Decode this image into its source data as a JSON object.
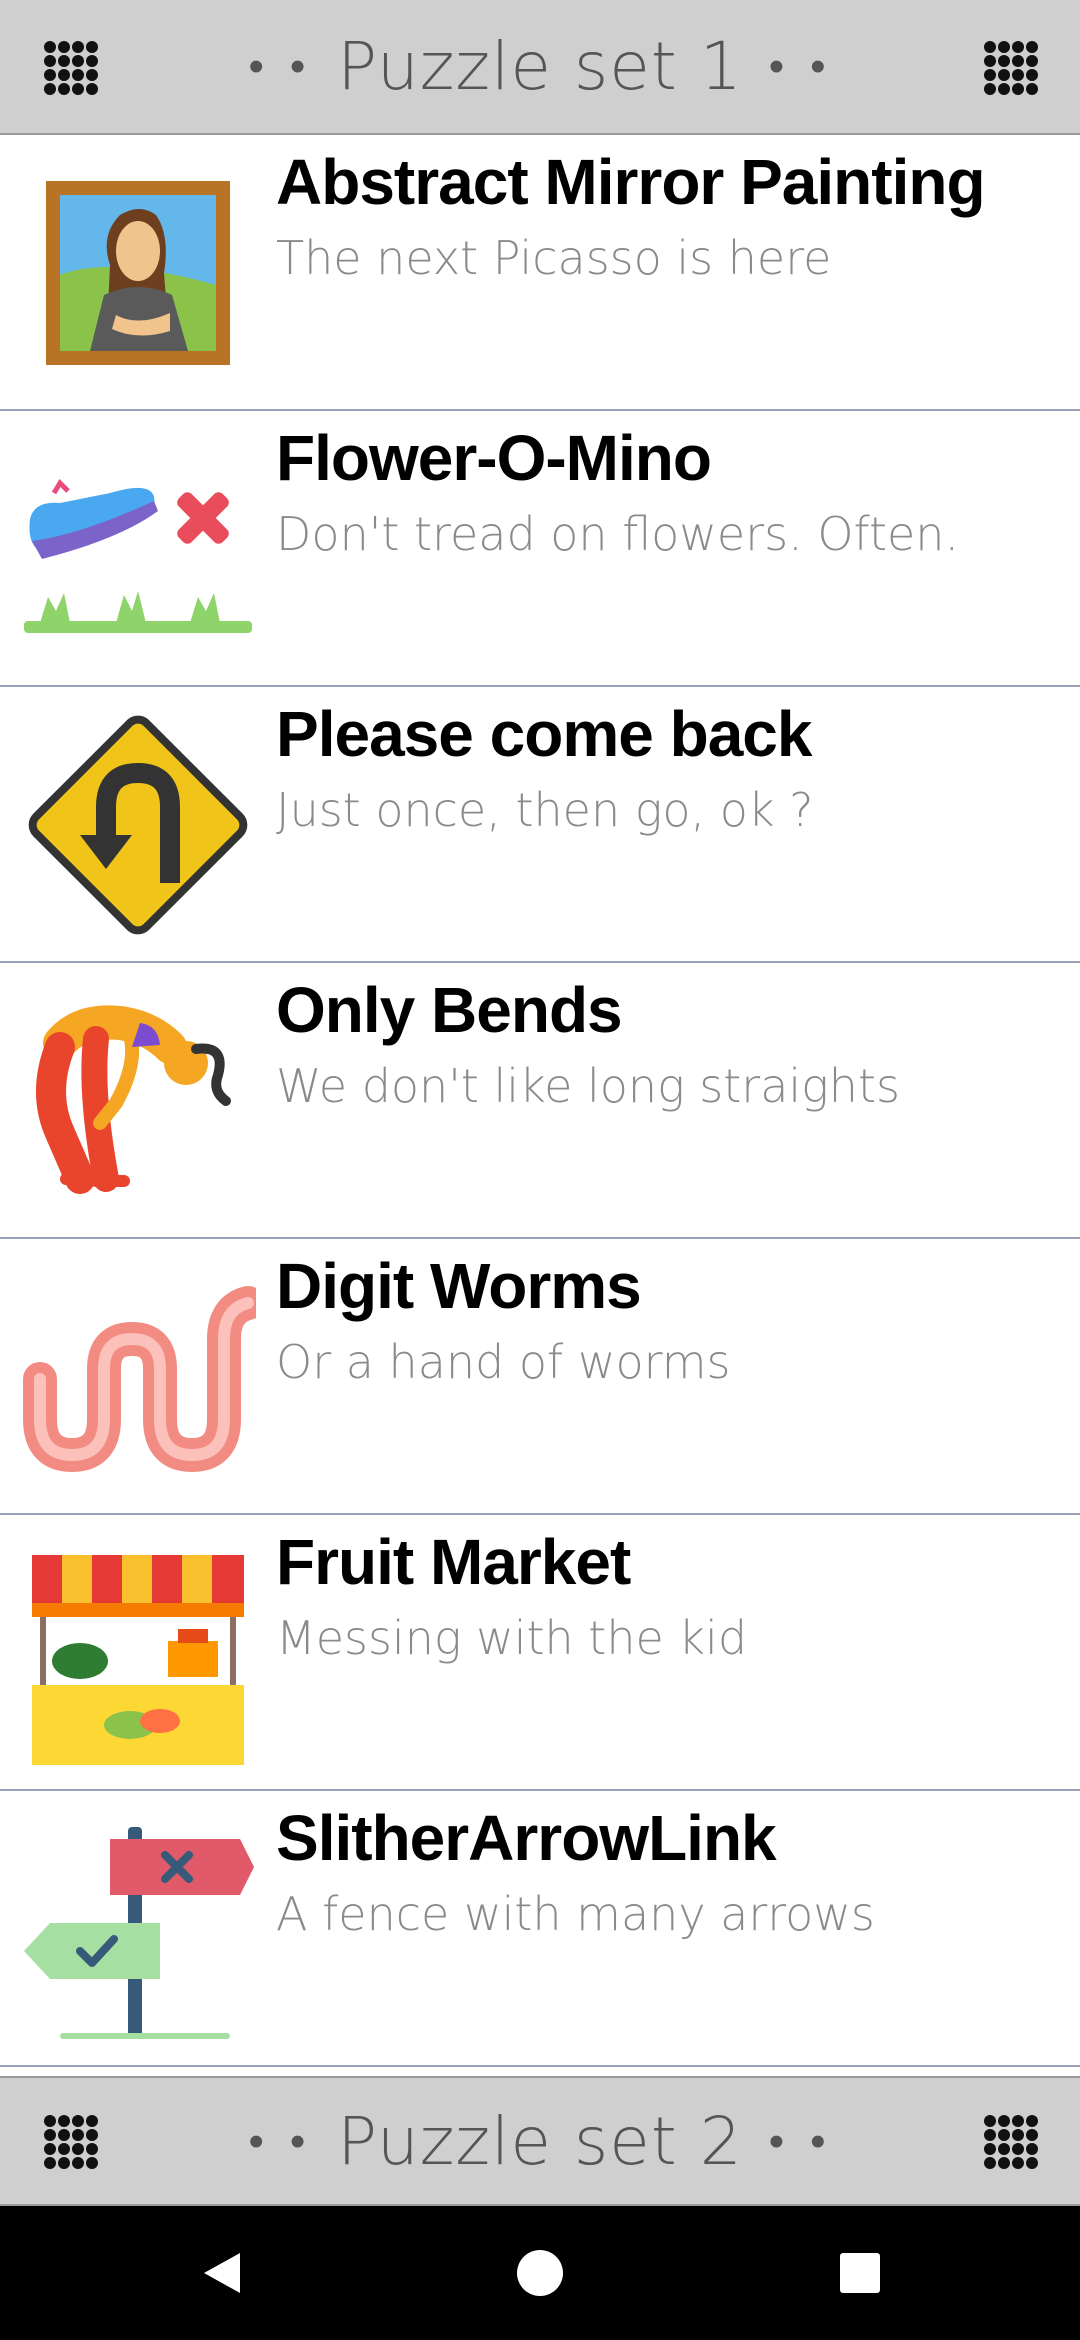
{
  "top_header": {
    "title": "Puzzle set 1",
    "dots_left": "• •",
    "dots_right": "• •"
  },
  "puzzles": [
    {
      "title": "Abstract Mirror Painting",
      "subtitle": "The next Picasso is here",
      "icon": "mona-lisa-painting-icon"
    },
    {
      "title": "Flower-O-Mino",
      "subtitle": "Don't tread on flowers. Often.",
      "icon": "shoe-on-grass-icon"
    },
    {
      "title": "Please come back",
      "subtitle": "Just once, then go, ok ?",
      "icon": "u-turn-sign-icon"
    },
    {
      "title": "Only Bends",
      "subtitle": "We don't like long straights",
      "icon": "bending-person-icon"
    },
    {
      "title": "Digit Worms",
      "subtitle": "Or a hand of worms",
      "icon": "worm-icon"
    },
    {
      "title": "Fruit Market",
      "subtitle": "Messing with the kid",
      "icon": "market-stall-icon"
    },
    {
      "title": "SlitherArrowLink",
      "subtitle": "A fence with many arrows",
      "icon": "signpost-icon"
    }
  ],
  "bottom_header": {
    "title": "Puzzle set 2",
    "dots_left": "• •",
    "dots_right": "• •"
  },
  "nav": {
    "back": "back-icon",
    "home": "home-icon",
    "recents": "recents-icon"
  }
}
